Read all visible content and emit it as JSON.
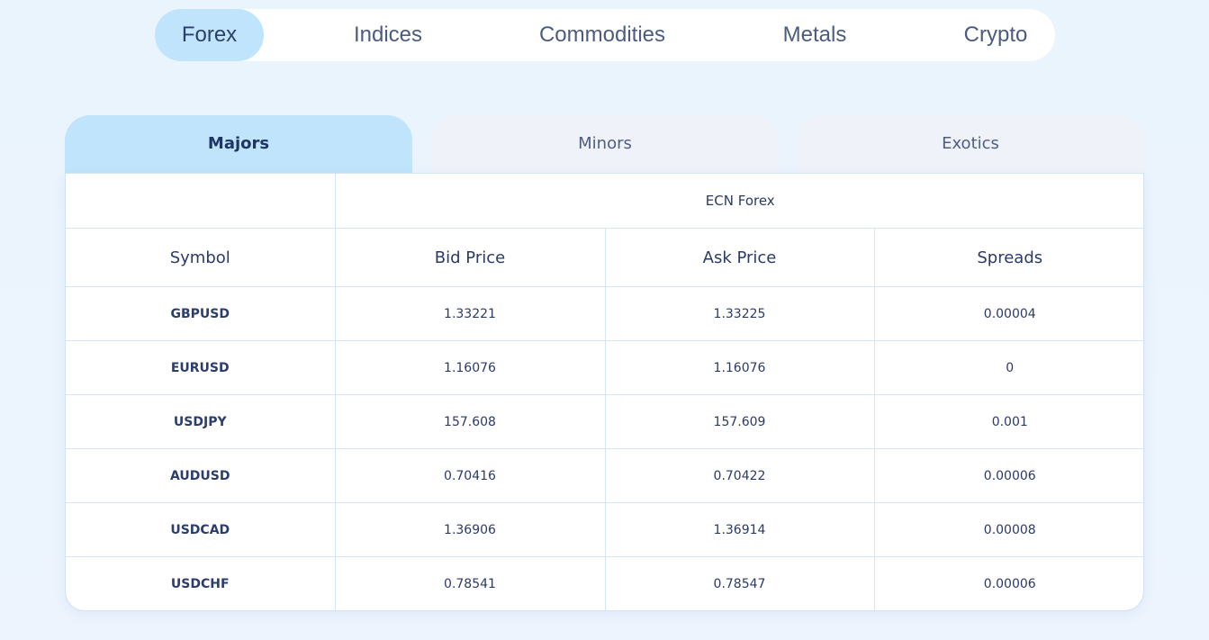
{
  "market_tabs": [
    {
      "label": "Forex",
      "active": true
    },
    {
      "label": "Indices",
      "active": false
    },
    {
      "label": "Commodities",
      "active": false
    },
    {
      "label": "Metals",
      "active": false
    },
    {
      "label": "Crypto",
      "active": false
    }
  ],
  "sub_tabs": [
    {
      "label": "Majors",
      "active": true
    },
    {
      "label": "Minors",
      "active": false
    },
    {
      "label": "Exotics",
      "active": false
    }
  ],
  "table": {
    "group_header": "ECN Forex",
    "columns": [
      "Symbol",
      "Bid Price",
      "Ask Price",
      "Spreads"
    ],
    "rows": [
      {
        "symbol": "GBPUSD",
        "bid": "1.33221",
        "ask": "1.33225",
        "spread": "0.00004"
      },
      {
        "symbol": "EURUSD",
        "bid": "1.16076",
        "ask": "1.16076",
        "spread": "0"
      },
      {
        "symbol": "USDJPY",
        "bid": "157.608",
        "ask": "157.609",
        "spread": "0.001"
      },
      {
        "symbol": "AUDUSD",
        "bid": "0.70416",
        "ask": "0.70422",
        "spread": "0.00006"
      },
      {
        "symbol": "USDCAD",
        "bid": "1.36906",
        "ask": "1.36914",
        "spread": "0.00008"
      },
      {
        "symbol": "USDCHF",
        "bid": "0.78541",
        "ask": "0.78547",
        "spread": "0.00006"
      }
    ]
  },
  "colors": {
    "active_tab": "#bfe4fb",
    "inactive_sub_tab": "#eff2f9",
    "text": "#2b3a67",
    "border": "#d3e6f2"
  }
}
